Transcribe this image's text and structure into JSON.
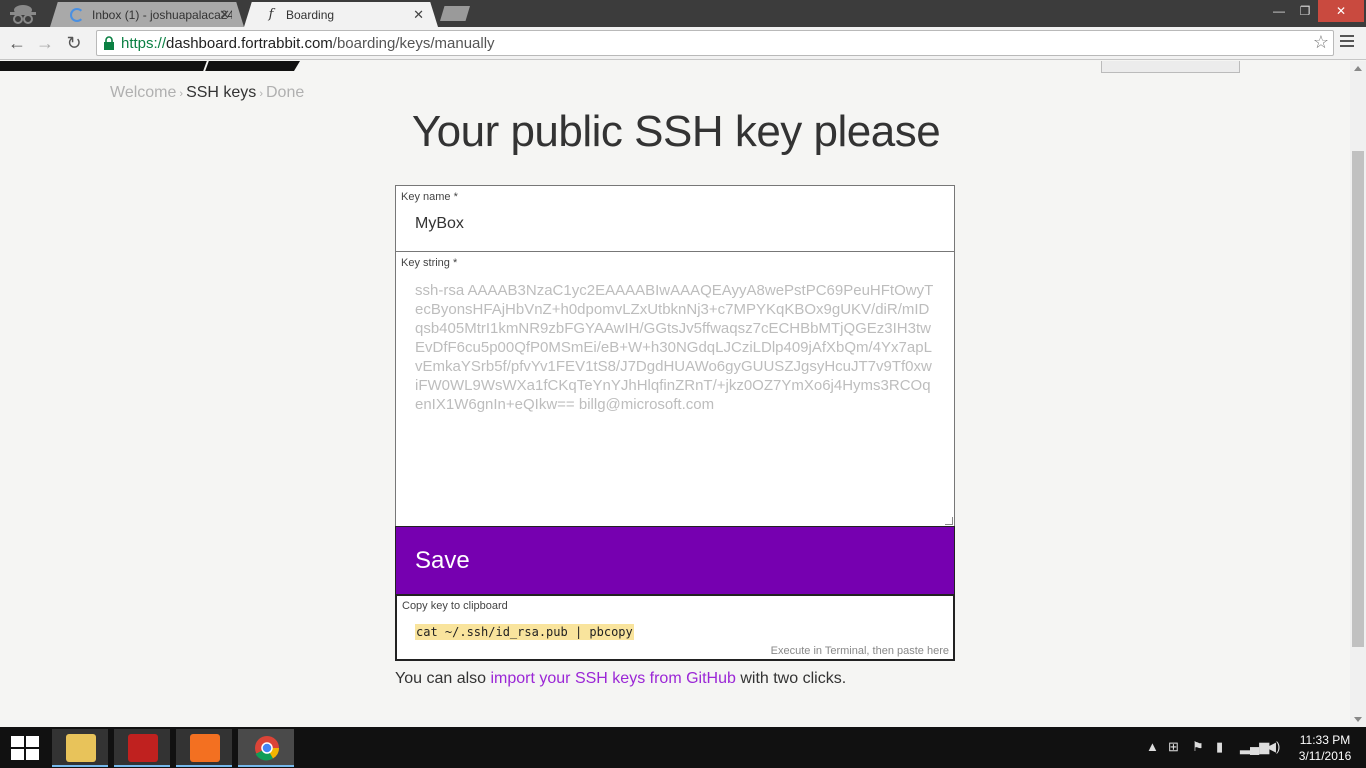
{
  "browser": {
    "tabs": [
      {
        "title": "Inbox (1) - joshuapalaca24",
        "state": "loading"
      },
      {
        "title": "Boarding",
        "state": "active"
      }
    ],
    "url": {
      "scheme": "https://",
      "host": "dashboard.fortrabbit.com",
      "path": "/boarding/keys/manually"
    }
  },
  "breadcrumb": {
    "step1": "Welcome",
    "step2": "SSH keys",
    "step3": "Done",
    "separator": "›"
  },
  "page": {
    "title": "Your public SSH key please"
  },
  "form": {
    "key_name_label": "Key name *",
    "key_name_value": "MyBox",
    "key_string_label": "Key string *",
    "key_string_placeholder": "ssh-rsa AAAAB3NzaC1yc2EAAAABIwAAAQEAyyA8wePstPC69PeuHFtOwyTecByonsHFAjHbVnZ+h0dpomvLZxUtbknNj3+c7MPYKqKBOx9gUKV/diR/mIDqsb405MtrI1kmNR9zbFGYAAwIH/GGtsJv5ffwaqsz7cECHBbMTjQGEz3IH3twEvDfF6cu5p00QfP0MSmEi/eB+W+h30NGdqLJCziLDlp409jAfXbQm/4Yx7apLvEmkaYSrb5f/pfvYv1FEV1tS8/J7DgdHUAWo6gyGUUSZJgsyHcuJT7v9Tf0xwiFW0WL9WsWXa1fCKqTeYnYJhHlqfinZRnT/+jkz0OZ7YmXo6j4Hyms3RCOqenIX1W6gnIn+eQIkw== billg@microsoft.com",
    "save_label": "Save",
    "copy_label": "Copy key to clipboard",
    "copy_command": "cat ~/.ssh/id_rsa.pub | pbcopy",
    "copy_hint": "Execute in Terminal, then paste here"
  },
  "footer_text": {
    "before": "You can also ",
    "link": "import your SSH keys from GitHub",
    "after": " with two clicks."
  },
  "colors": {
    "accent": "#7600b0",
    "link": "#9b27d6",
    "highlight": "#f9e49d"
  },
  "taskbar": {
    "time": "11:33 PM",
    "date": "3/11/2016"
  }
}
